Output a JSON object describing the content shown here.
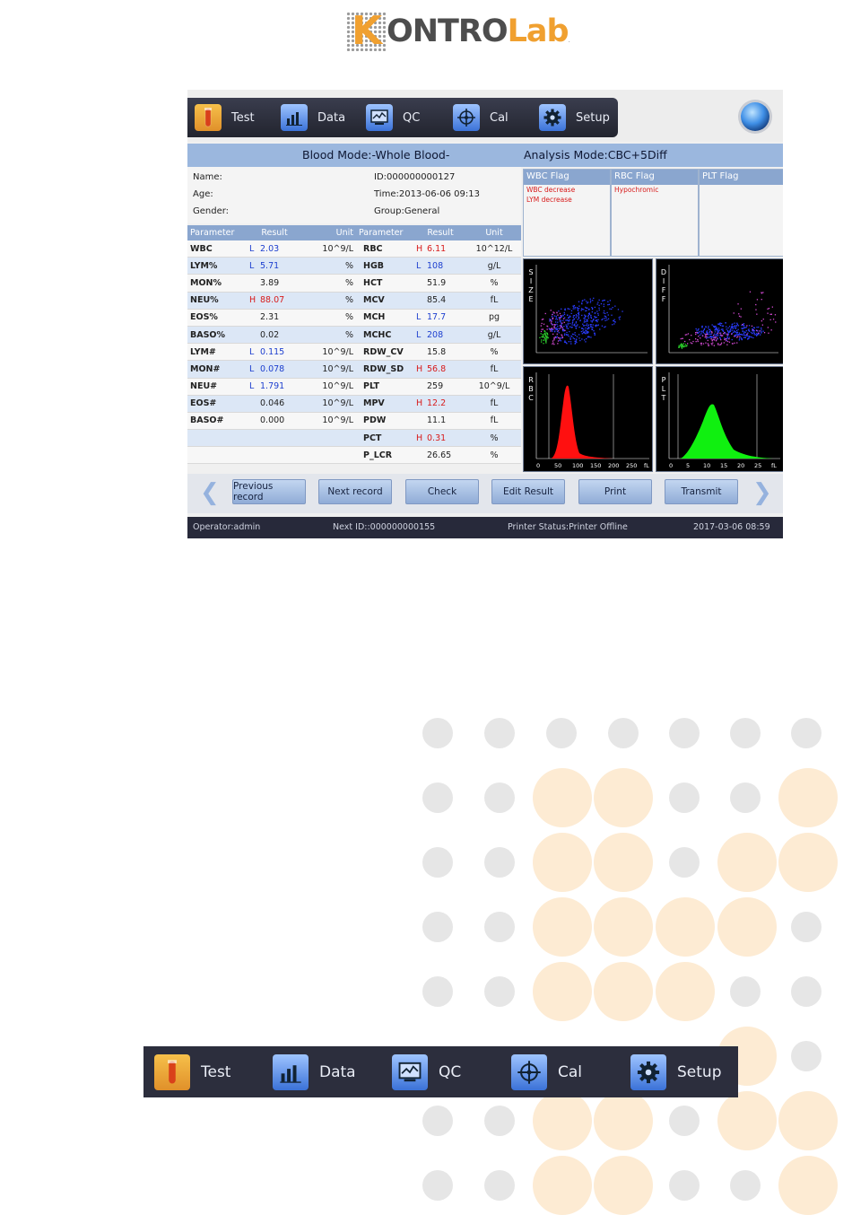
{
  "brand": {
    "logo_text": "KONTROLab"
  },
  "tabs": [
    {
      "label": "Test",
      "icon": "test-tube-icon"
    },
    {
      "label": "Data",
      "icon": "bar-chart-icon"
    },
    {
      "label": "QC",
      "icon": "monitor-chart-icon"
    },
    {
      "label": "Cal",
      "icon": "crosshair-icon"
    },
    {
      "label": "Setup",
      "icon": "gear-icon"
    }
  ],
  "mode": {
    "blood_mode": "Blood Mode:-Whole Blood-",
    "analysis_mode": "Analysis Mode:CBC+5Diff"
  },
  "patient": {
    "name_label": "Name:",
    "age_label": "Age:",
    "gender_label": "Gender:",
    "id": "ID:000000000127",
    "time": "Time:2013-06-06 09:13",
    "group": "Group:General"
  },
  "table": {
    "headers": [
      "Parameter",
      "Result",
      "Unit",
      "Parameter",
      "Result",
      "Unit"
    ],
    "rows": [
      {
        "p1": "WBC",
        "f1": "L",
        "r1": "2.03",
        "u1": "10^9/L",
        "p2": "RBC",
        "f2": "H",
        "r2": "6.11",
        "u2": "10^12/L"
      },
      {
        "p1": "LYM%",
        "f1": "L",
        "r1": "5.71",
        "u1": "%",
        "p2": "HGB",
        "f2": "L",
        "r2": "108",
        "u2": "g/L"
      },
      {
        "p1": "MON%",
        "f1": "",
        "r1": "3.89",
        "u1": "%",
        "p2": "HCT",
        "f2": "",
        "r2": "51.9",
        "u2": "%"
      },
      {
        "p1": "NEU%",
        "f1": "H",
        "r1": "88.07",
        "u1": "%",
        "p2": "MCV",
        "f2": "",
        "r2": "85.4",
        "u2": "fL"
      },
      {
        "p1": "EOS%",
        "f1": "",
        "r1": "2.31",
        "u1": "%",
        "p2": "MCH",
        "f2": "L",
        "r2": "17.7",
        "u2": "pg"
      },
      {
        "p1": "BASO%",
        "f1": "",
        "r1": "0.02",
        "u1": "%",
        "p2": "MCHC",
        "f2": "L",
        "r2": "208",
        "u2": "g/L"
      },
      {
        "p1": "LYM#",
        "f1": "L",
        "r1": "0.115",
        "u1": "10^9/L",
        "p2": "RDW_CV",
        "f2": "",
        "r2": "15.8",
        "u2": "%"
      },
      {
        "p1": "MON#",
        "f1": "L",
        "r1": "0.078",
        "u1": "10^9/L",
        "p2": "RDW_SD",
        "f2": "H",
        "r2": "56.8",
        "u2": "fL"
      },
      {
        "p1": "NEU#",
        "f1": "L",
        "r1": "1.791",
        "u1": "10^9/L",
        "p2": "PLT",
        "f2": "",
        "r2": "259",
        "u2": "10^9/L"
      },
      {
        "p1": "EOS#",
        "f1": "",
        "r1": "0.046",
        "u1": "10^9/L",
        "p2": "MPV",
        "f2": "H",
        "r2": "12.2",
        "u2": "fL"
      },
      {
        "p1": "BASO#",
        "f1": "",
        "r1": "0.000",
        "u1": "10^9/L",
        "p2": "PDW",
        "f2": "",
        "r2": "11.1",
        "u2": "fL"
      },
      {
        "p1": "",
        "f1": "",
        "r1": "",
        "u1": "",
        "p2": "PCT",
        "f2": "H",
        "r2": "0.31",
        "u2": "%"
      },
      {
        "p1": "",
        "f1": "",
        "r1": "",
        "u1": "",
        "p2": "P_LCR",
        "f2": "",
        "r2": "26.65",
        "u2": "%"
      }
    ]
  },
  "flags": {
    "wbc": {
      "title": "WBC Flag",
      "items": [
        "WBC decrease",
        "LYM decrease"
      ]
    },
    "rbc": {
      "title": "RBC Flag",
      "items": [
        "Hypochromic"
      ]
    },
    "plt": {
      "title": "PLT Flag",
      "items": []
    }
  },
  "plots": {
    "size_label": "SIZE",
    "diff_label": "DIFF",
    "rbc_label": "RBC",
    "plt_label": "PLT",
    "rbc_ticks": [
      "0",
      "50",
      "100",
      "150",
      "200",
      "250",
      "fL"
    ],
    "plt_ticks": [
      "0",
      "5",
      "10",
      "15",
      "20",
      "25",
      "fL"
    ],
    "colors": {
      "rbc_histogram": "#ff1010",
      "plt_histogram": "#10f010",
      "scatter_blue": "#2a3cff",
      "scatter_green": "#2bd12b",
      "scatter_magenta": "#d24ad2"
    }
  },
  "buttons": {
    "previous": "Previous record",
    "next": "Next record",
    "check": "Check",
    "edit": "Edit Result",
    "print": "Print",
    "transmit": "Transmit"
  },
  "status": {
    "operator": "Operator:admin",
    "next_id": "Next ID::000000000155",
    "printer": "Printer Status:Printer Offline",
    "datetime": "2017-03-06 08:59"
  }
}
